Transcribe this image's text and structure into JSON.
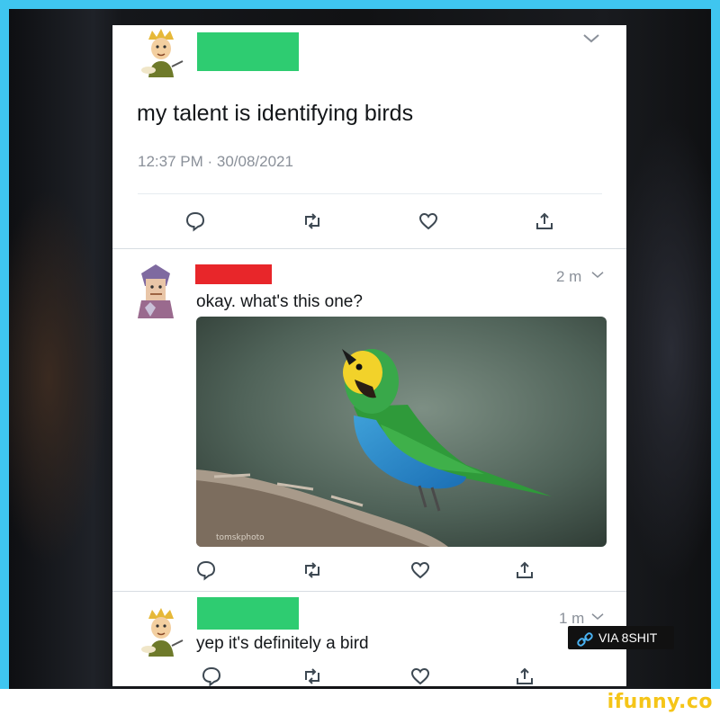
{
  "tweet_main": {
    "text": "my talent is identifying birds",
    "timestamp": "12:37 PM · 30/08/2021",
    "username_redaction_color": "#2ecc71"
  },
  "reply_1": {
    "age": "2 m",
    "text": "okay. what's this one?",
    "username_redaction_color": "#e8262a",
    "photo_watermark": "tomskphoto"
  },
  "reply_2": {
    "age": "1 m",
    "text": "yep it's definitely a bird",
    "username_redaction_color": "#2ecc71"
  },
  "badge": {
    "label": "VIA 8SHIT"
  },
  "brand": {
    "logo": "ifunny.co",
    "border_color": "#3fc6f0"
  },
  "icons": [
    "reply-icon",
    "retweet-icon",
    "like-icon",
    "share-icon",
    "chevron-down-icon",
    "link-icon"
  ]
}
